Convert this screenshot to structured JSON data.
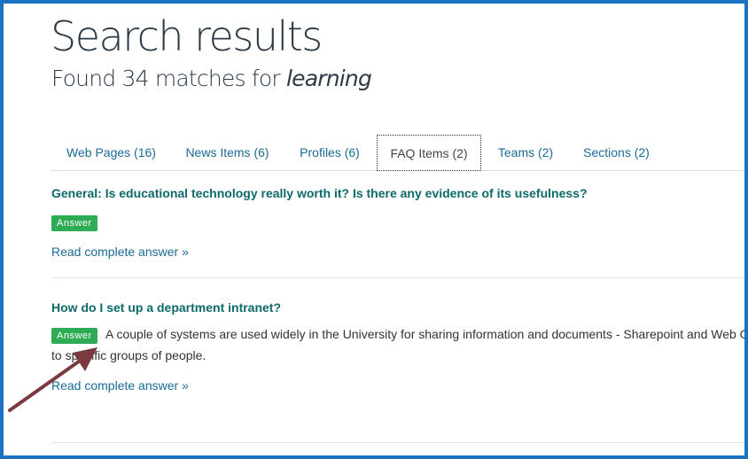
{
  "page": {
    "title": "Search results",
    "summary_prefix": "Found 34 matches for ",
    "query": "learning"
  },
  "tabs": [
    {
      "label": "Web Pages (16)",
      "active": false
    },
    {
      "label": "News Items (6)",
      "active": false
    },
    {
      "label": "Profiles (6)",
      "active": false
    },
    {
      "label": "FAQ Items (2)",
      "active": true
    },
    {
      "label": "Teams (2)",
      "active": false
    },
    {
      "label": "Sections (2)",
      "active": false
    }
  ],
  "results": [
    {
      "title": "General: Is educational technology really worth it? Is there any evidence of its usefulness?",
      "badge": "Answer",
      "snippet": "",
      "read_more": "Read complete answer »"
    },
    {
      "title": "How do I set up a department intranet?",
      "badge": "Answer",
      "snippet": "A couple of systems are used widely in the University for sharing information and documents - Sharepoint and Web On to specific groups of people.",
      "read_more": "Read complete answer »"
    }
  ],
  "colors": {
    "frame": "#1d73c2",
    "link": "#1a6b96",
    "result_title": "#0d6a6a",
    "badge": "#2eab55",
    "annotation_arrow": "#7a3a3f"
  }
}
